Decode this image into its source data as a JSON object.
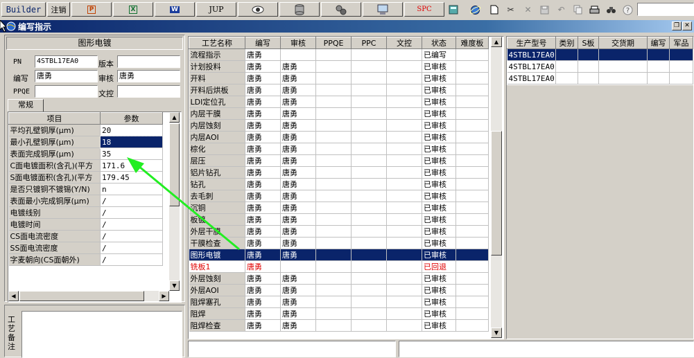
{
  "toolbar": {
    "builder_label": "Builder",
    "logout_label": "注销",
    "jup_label": "JUP",
    "spc_label": "SPC"
  },
  "window": {
    "title": "编写指示"
  },
  "left_panel": {
    "heading": "图形电镀",
    "pn_label": "PN",
    "pn_value": "4STBL17EA0",
    "version_label": "版本",
    "version_value": "",
    "writer_label": "编写",
    "writer_value": "唐勇",
    "reviewer_label": "审核",
    "reviewer_value": "唐勇",
    "ppqe_label": "PPQE",
    "ppqe_value": "",
    "doc_control_label": "文控",
    "doc_control_value": "",
    "tab_general": "常规",
    "param_headers": [
      "项目",
      "参数"
    ],
    "params": [
      {
        "item": "平均孔壁铜厚(μm)",
        "value": "20"
      },
      {
        "item": "最小孔壁铜厚(μm)",
        "value": "18"
      },
      {
        "item": "表面完成铜厚(μm)",
        "value": "35"
      },
      {
        "item": "C面电镀面积(含孔)(平方",
        "value": "171.6"
      },
      {
        "item": "S面电镀面积(含孔)(平方",
        "value": "179.45"
      },
      {
        "item": "是否只镀铜不镀锡(Y/N)",
        "value": "n"
      },
      {
        "item": "表面最小完成铜厚(μm)",
        "value": "/"
      },
      {
        "item": "电镀线别",
        "value": "/"
      },
      {
        "item": "电镀时间",
        "value": "/"
      },
      {
        "item": "CS面电流密度",
        "value": "/"
      },
      {
        "item": "SS面电流密度",
        "value": "/"
      },
      {
        "item": "字麦朝向(CS面朝外)",
        "value": "/"
      }
    ],
    "remark_label": "工艺备注"
  },
  "process_grid": {
    "headers": [
      "工艺名称",
      "编写",
      "审核",
      "PPQE",
      "PPC",
      "文控",
      "状态",
      "难度板"
    ],
    "rows": [
      {
        "name": "流程指示",
        "writer": "唐勇",
        "reviewer": "",
        "status": "已编写"
      },
      {
        "name": "计划投料",
        "writer": "唐勇",
        "reviewer": "唐勇",
        "status": "已审核"
      },
      {
        "name": "开料",
        "writer": "唐勇",
        "reviewer": "唐勇",
        "status": "已审核"
      },
      {
        "name": "开料后烘板",
        "writer": "唐勇",
        "reviewer": "唐勇",
        "status": "已审核"
      },
      {
        "name": "LDI定位孔",
        "writer": "唐勇",
        "reviewer": "唐勇",
        "status": "已审核"
      },
      {
        "name": "内层干膜",
        "writer": "唐勇",
        "reviewer": "唐勇",
        "status": "已审核"
      },
      {
        "name": "内层蚀刻",
        "writer": "唐勇",
        "reviewer": "唐勇",
        "status": "已审核"
      },
      {
        "name": "内层AOI",
        "writer": "唐勇",
        "reviewer": "唐勇",
        "status": "已审核"
      },
      {
        "name": "棕化",
        "writer": "唐勇",
        "reviewer": "唐勇",
        "status": "已审核"
      },
      {
        "name": "层压",
        "writer": "唐勇",
        "reviewer": "唐勇",
        "status": "已审核"
      },
      {
        "name": "铝片钻孔",
        "writer": "唐勇",
        "reviewer": "唐勇",
        "status": "已审核"
      },
      {
        "name": "钻孔",
        "writer": "唐勇",
        "reviewer": "唐勇",
        "status": "已审核"
      },
      {
        "name": "去毛刺",
        "writer": "唐勇",
        "reviewer": "唐勇",
        "status": "已审核"
      },
      {
        "name": "沉铜",
        "writer": "唐勇",
        "reviewer": "唐勇",
        "status": "已审核"
      },
      {
        "name": "板镀",
        "writer": "唐勇",
        "reviewer": "唐勇",
        "status": "已审核"
      },
      {
        "name": "外层干膜",
        "writer": "唐勇",
        "reviewer": "唐勇",
        "status": "已审核"
      },
      {
        "name": "干膜检查",
        "writer": "唐勇",
        "reviewer": "唐勇",
        "status": "已审核"
      },
      {
        "name": "图形电镀",
        "writer": "唐勇",
        "reviewer": "唐勇",
        "status": "已审核"
      },
      {
        "name": "铣板1",
        "writer": "唐勇",
        "reviewer": "",
        "status": "已回退"
      },
      {
        "name": "外层蚀刻",
        "writer": "唐勇",
        "reviewer": "唐勇",
        "status": "已审核"
      },
      {
        "name": "外层AOI",
        "writer": "唐勇",
        "reviewer": "唐勇",
        "status": "已审核"
      },
      {
        "name": "阻焊塞孔",
        "writer": "唐勇",
        "reviewer": "唐勇",
        "status": "已审核"
      },
      {
        "name": "阻焊",
        "writer": "唐勇",
        "reviewer": "唐勇",
        "status": "已审核"
      },
      {
        "name": "阻焊检查",
        "writer": "唐勇",
        "reviewer": "唐勇",
        "status": "已审核"
      }
    ]
  },
  "product_grid": {
    "headers": [
      "生产型号",
      "类别",
      "S板",
      "交货期",
      "编写",
      "军品"
    ],
    "rows": [
      {
        "model": "4STBL17EA0"
      },
      {
        "model": "4STBL17EA0"
      },
      {
        "model": "4STBL17EA0"
      }
    ]
  },
  "colors": {
    "selection": "#0a246a",
    "rolled_back": "#e00000",
    "arrow": "#22ee22"
  }
}
